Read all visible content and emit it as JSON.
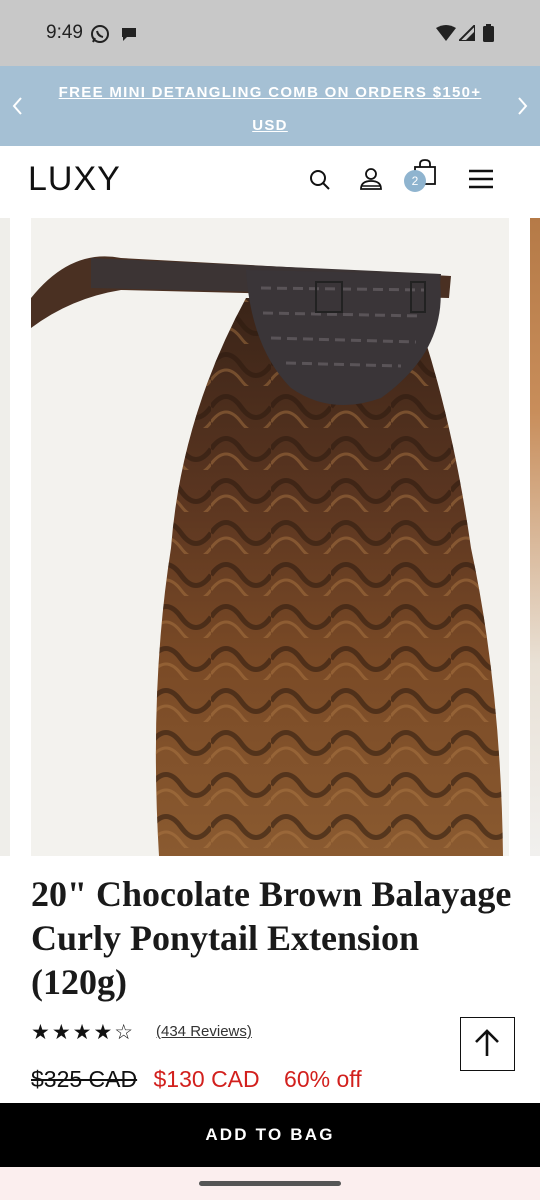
{
  "status_bar": {
    "time": "9:49",
    "icons": [
      "whatsapp-icon",
      "chat-icon",
      "wifi-icon",
      "signal-icon",
      "battery-icon"
    ]
  },
  "promo": {
    "text": "FREE MINI DETANGLING COMB ON ORDERS $150+ USD",
    "prev_icon": "chevron-left-icon",
    "next_icon": "chevron-right-icon",
    "background": "#a5c0d4"
  },
  "header": {
    "logo": "LUXY",
    "icons": [
      "search-icon",
      "account-icon",
      "cart-icon",
      "menu-icon"
    ],
    "cart_count": "2",
    "badge_color": "#8fb4cf"
  },
  "product": {
    "title": "20\" Chocolate Brown Balayage Curly Ponytail Extension (120g)",
    "rating": 4.5,
    "stars_text": "★★★★☆",
    "reviews": "(434 Reviews)",
    "price_original": "$325 CAD",
    "price_sale": "$130 CAD",
    "discount": "60% off",
    "sale_color": "#d2201d"
  },
  "cta": {
    "add_to_bag": "ADD TO BAG"
  }
}
